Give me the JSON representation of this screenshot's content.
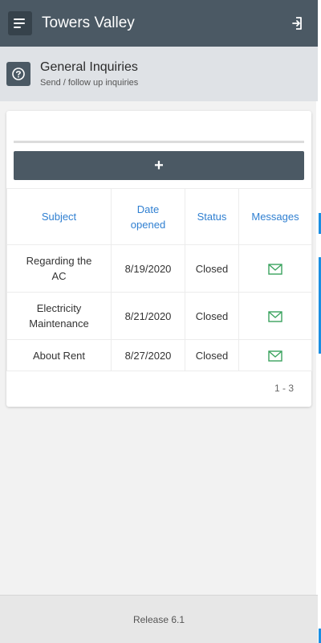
{
  "app": {
    "title": "Towers Valley",
    "colors": {
      "header_bg": "#4b5964",
      "link_blue": "#2f7fd1",
      "envelope_green": "#3aa35e",
      "footer_bg": "#e7e7e7"
    }
  },
  "icons": {
    "menu": "menu-icon",
    "logout": "logout-icon",
    "inquiry": "question-circle-icon",
    "message": "envelope-icon",
    "add": "plus-icon"
  },
  "page": {
    "title": "General Inquiries",
    "subtitle": "Send / follow up inquiries"
  },
  "toolbar": {
    "add_label": "+"
  },
  "table": {
    "headers": {
      "subject": "Subject",
      "date_line1": "Date",
      "date_line2": "opened",
      "status": "Status",
      "messages": "Messages"
    },
    "rows": [
      {
        "subject_line1": "Regarding the",
        "subject_line2": "AC",
        "date": "8/19/2020",
        "status": "Closed"
      },
      {
        "subject_line1": "Electricity",
        "subject_line2": "Maintenance",
        "date": "8/21/2020",
        "status": "Closed"
      },
      {
        "subject_line1": "About Rent",
        "subject_line2": "",
        "date": "8/27/2020",
        "status": "Closed"
      }
    ]
  },
  "pagination": {
    "range": "1 - 3"
  },
  "footer": {
    "release": "Release 6.1"
  }
}
